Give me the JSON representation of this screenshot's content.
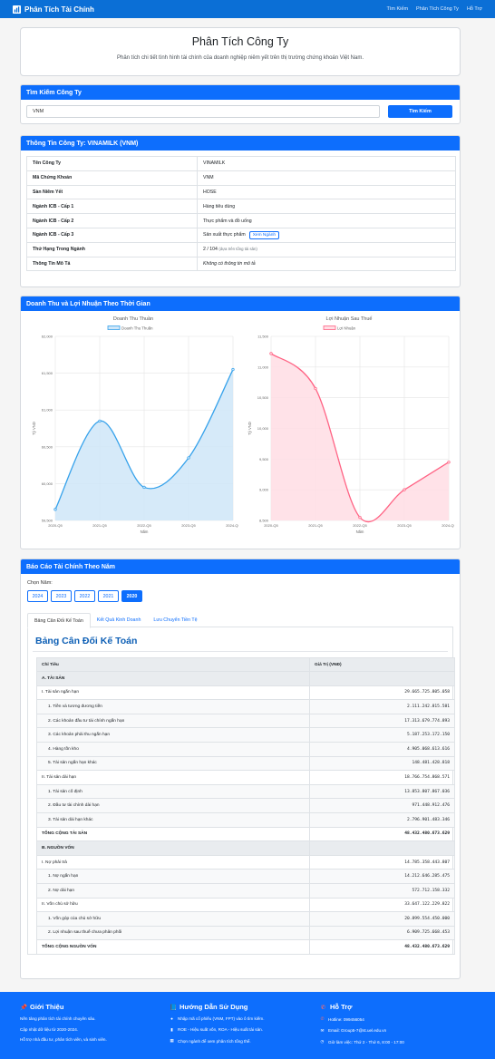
{
  "nav": {
    "brand": "Phân Tích Tài Chính",
    "links": [
      "Tìm Kiếm",
      "Phân Tích Công Ty",
      "Hỗ Trợ"
    ]
  },
  "hero": {
    "title": "Phân Tích Công Ty",
    "subtitle": "Phân tích chi tiết tình hình tài chính của doanh nghiệp niêm yết trên thị trường chứng khoán Việt Nam."
  },
  "search": {
    "header": "Tìm Kiếm Công Ty",
    "value": "VNM",
    "button": "Tìm Kiếm"
  },
  "info": {
    "header": "Thông Tin Công Ty: VINAMILK (VNM)",
    "rows": [
      {
        "k": "Tên Công Ty",
        "v": "VINAMILK"
      },
      {
        "k": "Mã Chứng Khoán",
        "v": "VNM"
      },
      {
        "k": "Sàn Niêm Yết",
        "v": "HOSE"
      },
      {
        "k": "Ngành ICB - Cấp 1",
        "v": "Hàng tiêu dùng"
      },
      {
        "k": "Ngành ICB - Cấp 2",
        "v": "Thực phẩm và đồ uống"
      },
      {
        "k": "Ngành ICB - Cấp 3",
        "v": "Sản xuất thực phẩm",
        "button": "Xem Ngành"
      },
      {
        "k": "Thứ Hạng Trong Ngành",
        "v": "2 / 104",
        "note": "(dựa trên tổng tài sản)"
      },
      {
        "k": "Thông Tin Mô Tả",
        "v": "Không có thông tin mô tả"
      }
    ]
  },
  "charts": {
    "header": "Doanh Thu và Lợi Nhuận Theo Thời Gian"
  },
  "chart_data": [
    {
      "type": "area",
      "title": "Doanh Thu Thuần",
      "series": [
        {
          "name": "Doanh Thu Thuần",
          "values": [
            59650,
            60850,
            59950,
            60350,
            61550
          ]
        }
      ],
      "categories": [
        "2020-Q5",
        "2021-Q5",
        "2022-Q5",
        "2023-Q5",
        "2024-Q5"
      ],
      "xlabel": "Năm",
      "ylabel": "Tỷ VND",
      "ylim": [
        59500,
        62000
      ],
      "yticks": [
        "59,500",
        "60,000",
        "60,500",
        "61,000",
        "61,500",
        "62,000"
      ],
      "color": "#36a2eb",
      "fill": "#cfe6f8",
      "legend": "top",
      "grid": true
    },
    {
      "type": "area",
      "title": "Lợi Nhuận Sau Thuế",
      "series": [
        {
          "name": "Lợi Nhuận",
          "values": [
            11220,
            10650,
            8550,
            9000,
            9450
          ]
        }
      ],
      "categories": [
        "2020-Q5",
        "2021-Q5",
        "2022-Q5",
        "2023-Q5",
        "2024-Q5"
      ],
      "xlabel": "Năm",
      "ylabel": "Tỷ VND",
      "ylim": [
        8500,
        11500
      ],
      "yticks": [
        "8,500",
        "9,000",
        "9,500",
        "10,000",
        "10,500",
        "11,000",
        "11,500"
      ],
      "color": "#ff6384",
      "fill": "#ffdde4",
      "legend": "top",
      "grid": true
    }
  ],
  "report": {
    "header": "Báo Cáo Tài Chính Theo Năm",
    "year_label": "Chọn Năm:",
    "years": [
      "2024",
      "2023",
      "2022",
      "2021",
      "2020"
    ],
    "active_year": "2020",
    "tabs": [
      "Bảng Cân Đối Kế Toán",
      "Kết Quả Kinh Doanh",
      "Lưu Chuyển Tiền Tệ"
    ],
    "title": "Bảng Cân Đối Kế Toán",
    "col_item": "Chỉ Tiêu",
    "col_value": "Giá Trị (VNĐ)",
    "rows": [
      {
        "t": "section",
        "l": "A. TÀI SẢN",
        "v": ""
      },
      {
        "t": "main",
        "l": "I. Tài sản ngắn hạn",
        "v": "29.665.725.805.058"
      },
      {
        "t": "sub",
        "l": "1. Tiền và tương đương tiền",
        "v": "2.111.242.815.581"
      },
      {
        "t": "sub",
        "l": "2. Các khoản đầu tư tài chính ngắn hạn",
        "v": "17.313.679.774.893"
      },
      {
        "t": "sub",
        "l": "3. Các khoản phải thu ngắn hạn",
        "v": "5.187.253.172.150"
      },
      {
        "t": "sub",
        "l": "4. Hàng tồn kho",
        "v": "4.905.068.613.616"
      },
      {
        "t": "sub",
        "l": "5. Tài sản ngắn hạn khác",
        "v": "148.481.428.818"
      },
      {
        "t": "main",
        "l": "II. Tài sản dài hạn",
        "v": "18.766.754.868.571"
      },
      {
        "t": "sub",
        "l": "1. Tài sản cố định",
        "v": "13.853.807.867.036"
      },
      {
        "t": "sub",
        "l": "2. Đầu tư tài chính dài hạn",
        "v": "971.448.912.476"
      },
      {
        "t": "sub",
        "l": "3. Tài sản dài hạn khác",
        "v": "2.796.901.483.346"
      },
      {
        "t": "total",
        "l": "TỔNG CỘNG TÀI SẢN",
        "v": "48.432.480.673.629"
      },
      {
        "t": "section",
        "l": "B. NGUỒN VỐN",
        "v": ""
      },
      {
        "t": "main",
        "l": "I. Nợ phải trả",
        "v": "14.785.358.443.807"
      },
      {
        "t": "sub",
        "l": "1. Nợ ngắn hạn",
        "v": "14.212.646.285.475"
      },
      {
        "t": "sub",
        "l": "2. Nợ dài hạn",
        "v": "572.712.158.332"
      },
      {
        "t": "main",
        "l": "II. Vốn chủ sở hữu",
        "v": "33.647.122.229.822"
      },
      {
        "t": "sub",
        "l": "1. Vốn góp của chủ sở hữu",
        "v": "20.899.554.450.000"
      },
      {
        "t": "sub",
        "l": "2. Lợi nhuận sau thuế chưa phân phối",
        "v": "6.909.725.668.453"
      },
      {
        "t": "total",
        "l": "TỔNG CỘNG NGUỒN VỐN",
        "v": "48.432.480.673.629"
      }
    ]
  },
  "footer": {
    "about_title": "Giới Thiệu",
    "about_lines": [
      "Nền tảng phân tích tài chính chuyên sâu.",
      "Cập nhật dữ liệu từ 2020-2024.",
      "Hỗ trợ nhà đầu tư, phân tích viên, và sinh viên."
    ],
    "guide_title": "Hướng Dẫn Sử Dụng",
    "guide_lines": [
      "Nhập mã cổ phiếu (VNM, FPT) vào ô tìm kiếm.",
      "ROE - Hiệu suất vốn, ROA - Hiệu suất tài sản.",
      "Chọn ngành để xem phân tích tổng thể."
    ],
    "support_title": "Hỗ Trợ",
    "support_lines": [
      "Hotline: 099456054",
      "Email: Group5-7@st.uel.edu.vn",
      "Giờ làm việc: Thứ 2 - Thứ 6, 8:00 - 17:00"
    ],
    "icons": {
      "about": "pin-icon",
      "guide": "book-icon",
      "support": "phone-icon"
    }
  }
}
